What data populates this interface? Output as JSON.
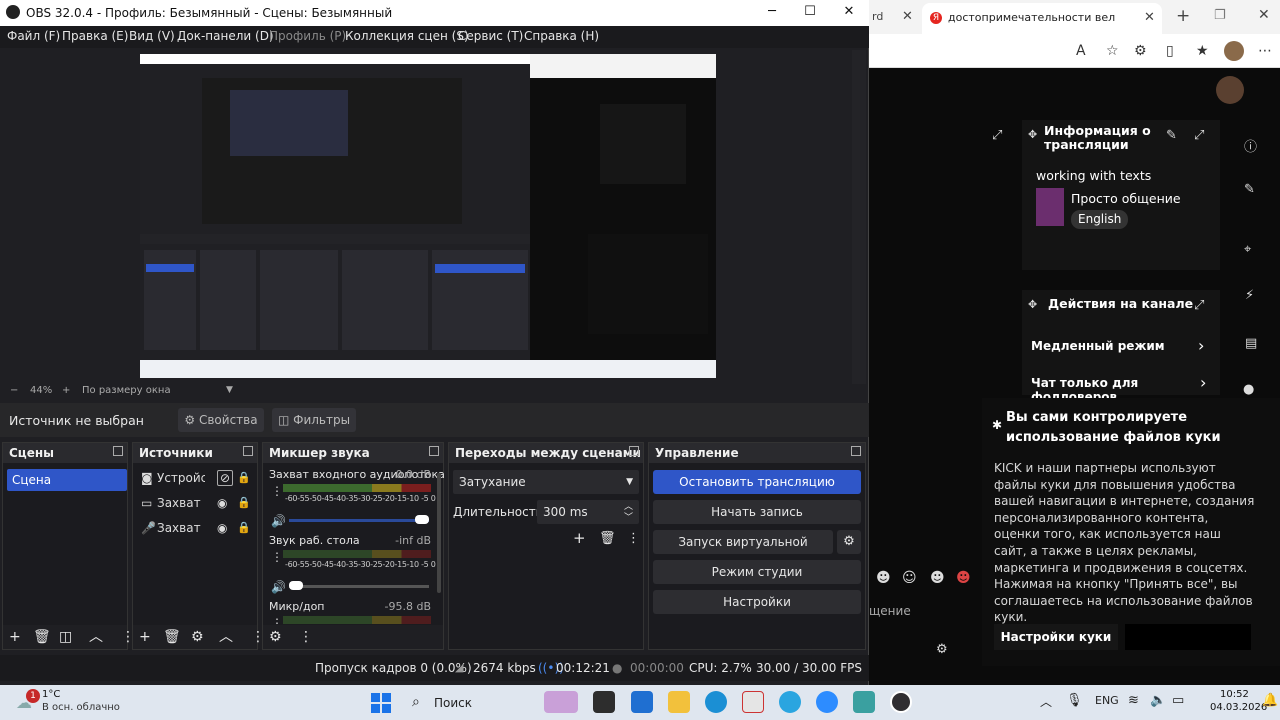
{
  "browser": {
    "tab_partial": "rd",
    "tab_active": "достопримечательности вел",
    "kick": {
      "stream_info_title": "Информация о трансляции",
      "stream_category_title": "working with texts",
      "tag_chat": "Просто общение",
      "tag_lang": "English",
      "channel_actions": "Действия на канале",
      "slow_mode": "Медленный режим",
      "followers_chat": "Чат только для фолловеров",
      "chat_partial": "щение",
      "cookie_heading": "Вы сами контролируете использование файлов куки",
      "cookie_text": "KICK и наши партнеры используют файлы куки для повышения удобства вашей навигации в интернете, создания персонализированного контента, оценки того, как используется наш сайт, а также в целях рекламы, маркетинга и продвижения в соцсетях. Нажимая на кнопку \"Принять все\", вы соглашаетесь на использование файлов куки.",
      "cookie_settings": "Настройки куки"
    }
  },
  "obs": {
    "title": "OBS 32.0.4 - Профиль: Безымянный - Сцены: Безымянный",
    "menu": [
      "Файл (F)",
      "Правка (E)",
      "Вид (V)",
      "Док-панели (D)",
      "Профиль (P)",
      "Коллекция сцен (S)",
      "Сервис (T)",
      "Справка (H)"
    ],
    "zoom": {
      "minus": "−",
      "value": "44%",
      "plus": "+",
      "fit": "По размеру окна"
    },
    "source_bar": {
      "label": "Источник не выбран",
      "properties": "Свойства",
      "filters": "Фильтры"
    },
    "docks": {
      "scenes": {
        "title": "Сцены",
        "items": [
          "Сцена"
        ]
      },
      "sources": {
        "title": "Источники",
        "items": [
          "Устройство захвата",
          "Захват экрана",
          "Захват входного аудиопотока"
        ]
      },
      "mixer": {
        "title": "Микшер звука",
        "channels": [
          {
            "name": "Захват входного аудиопотока",
            "db": "0.0 dB",
            "level": 1.0
          },
          {
            "name": "Звук раб. стола",
            "db": "-inf dB",
            "level": 0.0
          },
          {
            "name": "Микр/доп",
            "db": "-95.8 dB",
            "level": 0.0
          }
        ],
        "scale": "-60-55-50-45-40-35-30-25-20-15-10 -5 0"
      },
      "transitions": {
        "title": "Переходы между сценами",
        "type": "Затухание",
        "duration_label": "Длительность",
        "duration": "300 ms"
      },
      "controls": {
        "title": "Управление",
        "stop_stream": "Остановить трансляцию",
        "start_record": "Начать запись",
        "virtual_cam": "Запуск виртуальной камеры",
        "studio_mode": "Режим студии",
        "settings": "Настройки"
      }
    },
    "status": {
      "dropped": "Пропуск кадров 0 (0.0%)",
      "bitrate": "2674 kbps",
      "stream_time": "00:12:21",
      "rec_time": "00:00:00",
      "cpu": "CPU: 2.7%",
      "fps": "30.00 / 30.00 FPS"
    }
  },
  "taskbar": {
    "weather_temp": "1°C",
    "weather_desc": "В осн. облачно",
    "weather_badge": "1",
    "search": "Поиск",
    "lang": "ENG",
    "time": "10:52",
    "date": "04.03.2026"
  },
  "colors": {
    "accent": "#2f56c8",
    "obs_bg": "#1f1f23"
  }
}
